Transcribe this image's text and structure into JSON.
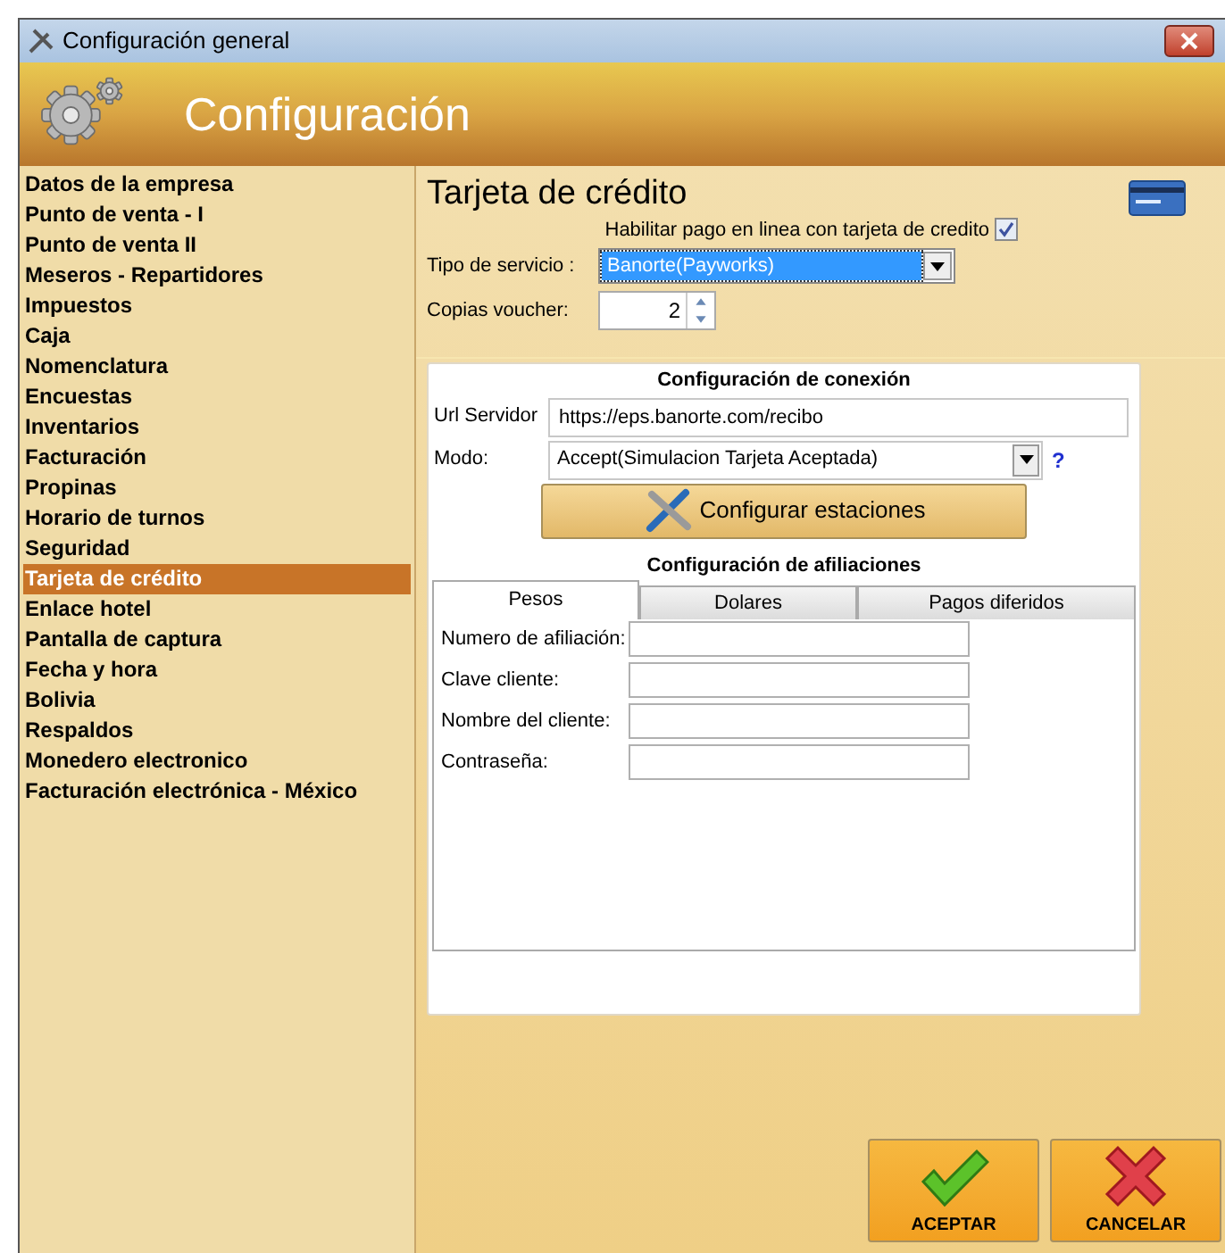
{
  "window": {
    "title": "Configuración general"
  },
  "header": {
    "title": "Configuración"
  },
  "sidebar": {
    "items": [
      {
        "label": "Datos de la empresa",
        "selected": false
      },
      {
        "label": "Punto de venta - I",
        "selected": false
      },
      {
        "label": "Punto de venta II",
        "selected": false
      },
      {
        "label": "Meseros - Repartidores",
        "selected": false
      },
      {
        "label": "Impuestos",
        "selected": false
      },
      {
        "label": "Caja",
        "selected": false
      },
      {
        "label": "Nomenclatura",
        "selected": false
      },
      {
        "label": "Encuestas",
        "selected": false
      },
      {
        "label": "Inventarios",
        "selected": false
      },
      {
        "label": "Facturación",
        "selected": false
      },
      {
        "label": "Propinas",
        "selected": false
      },
      {
        "label": "Horario de turnos",
        "selected": false
      },
      {
        "label": "Seguridad",
        "selected": false
      },
      {
        "label": "Tarjeta de crédito",
        "selected": true
      },
      {
        "label": "Enlace hotel",
        "selected": false
      },
      {
        "label": "Pantalla de captura",
        "selected": false
      },
      {
        "label": "Fecha y hora",
        "selected": false
      },
      {
        "label": "Bolivia",
        "selected": false
      },
      {
        "label": "Respaldos",
        "selected": false
      },
      {
        "label": "Monedero electronico",
        "selected": false
      },
      {
        "label": "Facturación electrónica - México",
        "selected": false
      }
    ]
  },
  "panel": {
    "title": "Tarjeta de crédito",
    "enable_online": {
      "label": "Habilitar pago en linea con tarjeta de credito",
      "checked": true
    },
    "service_type": {
      "label": "Tipo de servicio :",
      "value": "Banorte(Payworks)"
    },
    "voucher_copies": {
      "label": "Copias voucher:",
      "value": "2"
    },
    "connection": {
      "title": "Configuración de conexión",
      "url": {
        "label": "Url Servidor",
        "value": "https://eps.banorte.com/recibo"
      },
      "mode": {
        "label": "Modo:",
        "value": "Accept(Simulacion Tarjeta Aceptada)",
        "help": "?"
      },
      "configure_button": "Configurar estaciones"
    },
    "affiliations": {
      "title": "Configuración de afiliaciones",
      "tabs": [
        {
          "label": "Pesos",
          "selected": true
        },
        {
          "label": "Dolares",
          "selected": false
        },
        {
          "label": "Pagos diferidos",
          "selected": false
        }
      ],
      "fields": [
        {
          "label": "Numero de afiliación:"
        },
        {
          "label": "Clave cliente:"
        },
        {
          "label": "Nombre del cliente:"
        },
        {
          "label": "Contraseña:"
        }
      ]
    }
  },
  "buttons": [
    {
      "label": "ACEPTAR",
      "kind": "accept"
    },
    {
      "label": "CANCELAR",
      "kind": "cancel"
    }
  ]
}
